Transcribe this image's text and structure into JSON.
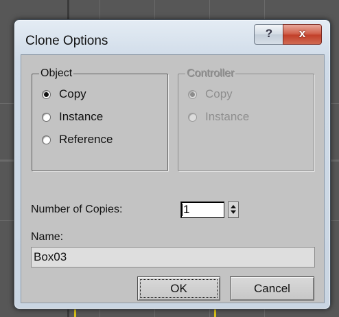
{
  "dialog": {
    "title": "Clone Options",
    "help_label": "?",
    "close_label": "x"
  },
  "object_group": {
    "legend": "Object",
    "options": [
      {
        "label": "Copy",
        "checked": true
      },
      {
        "label": "Instance",
        "checked": false
      },
      {
        "label": "Reference",
        "checked": false
      }
    ]
  },
  "controller_group": {
    "legend": "Controller",
    "disabled": true,
    "options": [
      {
        "label": "Copy",
        "checked": true
      },
      {
        "label": "Instance",
        "checked": false
      }
    ]
  },
  "copies": {
    "label": "Number of Copies:",
    "value": "1"
  },
  "name": {
    "label": "Name:",
    "value": "Box03"
  },
  "buttons": {
    "ok": "OK",
    "cancel": "Cancel"
  }
}
